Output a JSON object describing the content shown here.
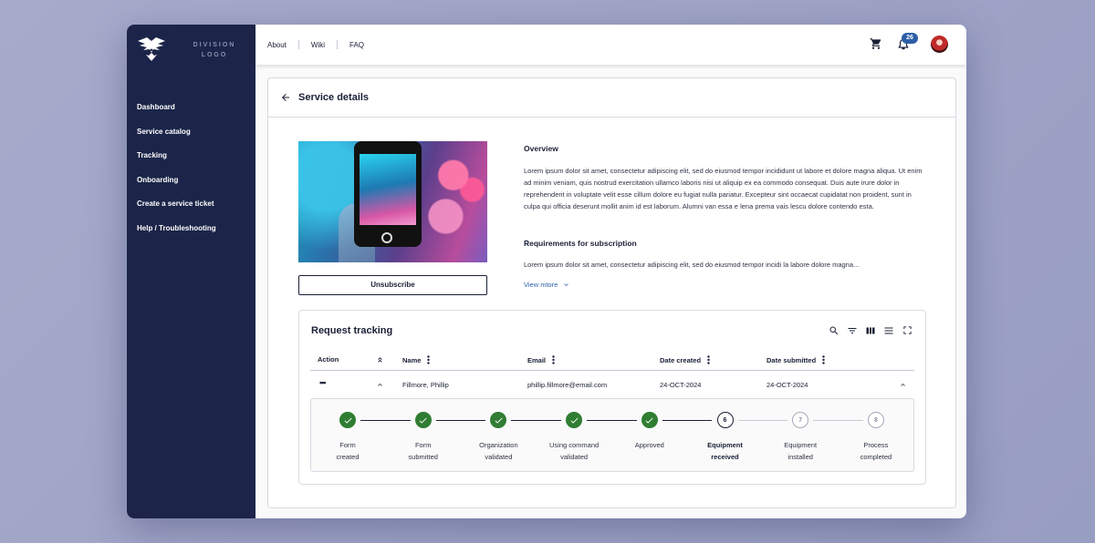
{
  "sidebar": {
    "logo_text": "DIVISION LOGO",
    "items": [
      {
        "label": "Dashboard"
      },
      {
        "label": "Service catalog"
      },
      {
        "label": "Tracking"
      },
      {
        "label": "Onboarding"
      },
      {
        "label": "Create a service ticket"
      },
      {
        "label": "Help / Troubleshooting"
      }
    ]
  },
  "topbar": {
    "links": [
      {
        "label": "About"
      },
      {
        "label": "Wiki"
      },
      {
        "label": "FAQ"
      }
    ],
    "notification_count": "26",
    "icons": [
      "cart-icon",
      "bell-icon",
      "avatar"
    ]
  },
  "page": {
    "title": "Service details",
    "unsubscribe_label": "Unsubscribe",
    "overview_title": "Overview",
    "overview_text": "Lorem ipsum dolor sit amet, consectetur adipiscing elit, sed do eiusmod tempor incididunt ut labore et dolore magna aliqua. Ut enim ad minim veniam, quis nostrud exercitation ullamco laboris nisi ut aliquip ex ea commodo consequat. Duis aute irure dolor in reprehenderit in voluptate velit esse cillum dolore eu fugiat nulla pariatur. Excepteur sint occaecat cupidatat non proident, sunt in culpa qui officia deserunt mollit anim id est laborum. Alumni van essa e lena prema vais lescu dolore contendo esta.",
    "requirements_title": "Requirements for subscription",
    "requirements_text": "Lorem ipsum dolor sit amet, consectetur adipiscing elit, sed do eiusmod tempor incidi la labore dolore magna...",
    "view_more_label": "View mtore"
  },
  "tracking": {
    "title": "Request tracking",
    "columns": {
      "action": "Action",
      "name": "Name",
      "email": "Email",
      "date_created": "Date created",
      "date_submitted": "Date submitted"
    },
    "row": {
      "action": "•••",
      "name": "Fillmore, Phillip",
      "email": "phillip.fillmore@email.com",
      "date_created": "24-OCT-2024",
      "date_submitted": "24-OCT-2024"
    },
    "steps": [
      {
        "number": "1",
        "label_1": "Form",
        "label_2": "created",
        "status": "done"
      },
      {
        "number": "2",
        "label_1": "Form",
        "label_2": "submitted",
        "status": "done"
      },
      {
        "number": "3",
        "label_1": "Organization",
        "label_2": "validated",
        "status": "done"
      },
      {
        "number": "4",
        "label_1": "Using command",
        "label_2": "validated",
        "status": "done"
      },
      {
        "number": "5",
        "label_1": "Approved",
        "label_2": "",
        "status": "done"
      },
      {
        "number": "6",
        "label_1": "Equipment",
        "label_2": "received",
        "status": "current"
      },
      {
        "number": "7",
        "label_1": "Equipment",
        "label_2": "installed",
        "status": "todo"
      },
      {
        "number": "8",
        "label_1": "Process",
        "label_2": "completed",
        "status": "todo"
      }
    ]
  },
  "colors": {
    "sidebar": "#1c2549",
    "accent": "#2d5fa6",
    "success": "#2f7d32",
    "background": "#a6aacb"
  }
}
